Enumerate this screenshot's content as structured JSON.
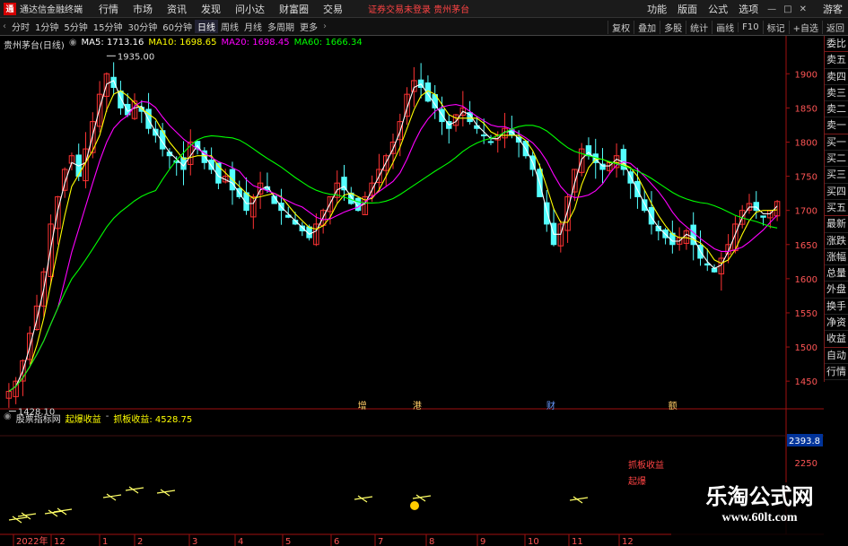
{
  "app": {
    "title": "通达信金融终端",
    "logo_text": "通"
  },
  "menu": {
    "items": [
      "行情",
      "市场",
      "资讯",
      "发现",
      "问小达",
      "财富圈",
      "交易"
    ],
    "center_text": "证券交易未登录  贵州茅台",
    "right_items": [
      "功能",
      "版面",
      "公式",
      "选项"
    ],
    "guest_label": "游客",
    "minimize": "—",
    "maximize": "□",
    "close": "✕"
  },
  "toolbar": {
    "periods": [
      "分时",
      "1分钟",
      "5分钟",
      "15分钟",
      "30分钟",
      "60分钟",
      "日线",
      "周线",
      "月线",
      "多周期",
      "更多"
    ],
    "active_period": "日线",
    "right_items": [
      "复权",
      "叠加",
      "多股",
      "统计",
      "画线",
      "F10",
      "标记",
      "+自选",
      "返回"
    ]
  },
  "chart_data": [
    {
      "type": "candlestick",
      "stock": "贵州茅台(日线)",
      "legend": [
        {
          "name": "MA5",
          "value": "1713.16",
          "color": "#ffffff"
        },
        {
          "name": "MA10",
          "value": "1698.65",
          "color": "#ffff00"
        },
        {
          "name": "MA20",
          "value": "1698.45",
          "color": "#ff00ff"
        },
        {
          "name": "MA60",
          "value": "1666.34",
          "color": "#00ff00"
        }
      ],
      "ylim": [
        1420,
        1945
      ],
      "yticks": [
        1450,
        1500,
        1550,
        1600,
        1650,
        1700,
        1750,
        1800,
        1850,
        1900
      ],
      "annotations": {
        "high": "1935.00",
        "low": "1428.10"
      },
      "event_markers": [
        "增",
        "港",
        "财",
        "额"
      ],
      "close_path": [
        1435,
        1450,
        1480,
        1520,
        1560,
        1610,
        1680,
        1720,
        1760,
        1780,
        1750,
        1790,
        1830,
        1870,
        1900,
        1880,
        1850,
        1840,
        1860,
        1845,
        1820,
        1810,
        1790,
        1780,
        1770,
        1760,
        1800,
        1790,
        1770,
        1760,
        1740,
        1750,
        1730,
        1720,
        1700,
        1720,
        1740,
        1730,
        1710,
        1700,
        1690,
        1680,
        1670,
        1660,
        1680,
        1700,
        1720,
        1740,
        1730,
        1710,
        1700,
        1720,
        1740,
        1760,
        1780,
        1800,
        1830,
        1870,
        1890,
        1880,
        1860,
        1850,
        1830,
        1820,
        1840,
        1850,
        1830,
        1820,
        1810,
        1800,
        1810,
        1820,
        1810,
        1800,
        1780,
        1760,
        1720,
        1680,
        1650,
        1680,
        1720,
        1760,
        1790,
        1780,
        1770,
        1760,
        1770,
        1780,
        1760,
        1740,
        1720,
        1700,
        1680,
        1670,
        1660,
        1650,
        1660,
        1670,
        1650,
        1630,
        1620,
        1610,
        1630,
        1650,
        1680,
        1700,
        1710,
        1700,
        1690,
        1700,
        1713
      ]
    },
    {
      "type": "bar",
      "indicator": "股票指标网",
      "name_a": "起爆收益",
      "name_b": "抓板收益",
      "value": "4528.75",
      "scale_label": "2393.8",
      "scale_label2": "2250",
      "labels": [
        "抓板收益",
        "起爆"
      ]
    }
  ],
  "xaxis": {
    "labels": [
      "2022年",
      "12",
      "1",
      "2",
      "3",
      "4",
      "5",
      "6",
      "7",
      "8",
      "9",
      "10",
      "11",
      "12"
    ]
  },
  "quote_panel": [
    "委比",
    "卖五",
    "卖四",
    "卖三",
    "卖二",
    "卖一",
    "买一",
    "买二",
    "买三",
    "买四",
    "买五",
    "最新",
    "涨跌",
    "涨幅",
    "总量",
    "外盘",
    "换手",
    "净资",
    "收益",
    "自动",
    "行情"
  ],
  "watermark": {
    "title": "乐淘公式网",
    "url": "www.60lt.com"
  },
  "colors": {
    "up": "#ff3333",
    "down": "#54ffff",
    "axis": "#a01010",
    "ma5": "#ffffff",
    "ma10": "#ffff00",
    "ma20": "#ff00ff",
    "ma60": "#00ff00"
  }
}
